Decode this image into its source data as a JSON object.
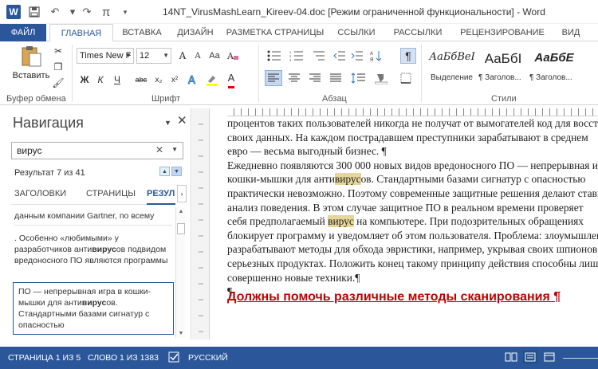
{
  "window": {
    "title": "14NT_VirusMashLearn_Kireev-04.doc [Режим ограниченной функциональности] - Word",
    "logo": "W",
    "qa_icons": [
      "save-icon",
      "undo-icon",
      "redo-icon",
      "pi-icon",
      "customize-icon"
    ],
    "qa_pi": "π"
  },
  "tabs": [
    "ФАЙЛ",
    "ГЛАВНАЯ",
    "ВСТАВКА",
    "ДИЗАЙН",
    "РАЗМЕТКА СТРАНИЦЫ",
    "ССЫЛКИ",
    "РАССЫЛКИ",
    "РЕЦЕНЗИРОВАНИЕ",
    "ВИД"
  ],
  "ribbon": {
    "clipboard": {
      "paste_label": "Вставить",
      "group_label": "Буфер обмена"
    },
    "font": {
      "font_name": "Times New F",
      "font_size": "12",
      "group_label": "Шрифт",
      "bold": "Ж",
      "italic": "К",
      "underline": "Ч",
      "strike": "abc",
      "sub": "x₂",
      "sup": "x²",
      "font_color_letter": "A",
      "grow": "A",
      "shrink": "A",
      "case": "Aa"
    },
    "paragraph": {
      "group_label": "Абзац"
    },
    "styles": {
      "group_label": "Стили",
      "items": [
        {
          "sample": "АаБбВеI",
          "name": "Выделение"
        },
        {
          "sample": "АаБбІ",
          "name": "¶ Заголов..."
        },
        {
          "sample": "АаБбЕ",
          "name": "¶ Заголов..."
        }
      ]
    }
  },
  "nav": {
    "title": "Навигация",
    "search_value": "вирус",
    "result_count": "Результат 7 из 41",
    "tabs": [
      "ЗАГОЛОВКИ",
      "СТРАНИЦЫ",
      "РЕЗУЛ"
    ],
    "results": [
      {
        "text": "данным компании Gartner, по всему"
      },
      {
        "text": ". Особенно «любимыми» у разработчиков анти",
        "bold": "вирус",
        "text2": "ов подвидом вредоносного ПО являются программы"
      },
      {
        "text": "ПО — непрерывная игра в кошки-мышки для анти",
        "bold": "вирус",
        "text2": "ов. Стандартными базами сигнатур с опасностью"
      }
    ]
  },
  "document": {
    "lines": [
      "процентов таких пользователей никогда не получат от вымогателей код для восстановления",
      "своих данных. На каждом пострадавшем преступники зарабатывают в среднем",
      "евро — весьма выгодный бизнес. ¶",
      "    Ежедневно появляются 300 000 новых видов вредоносного ПО — непрерывная игра в",
      "кошки-мышки для анти|вирус|ов. Стандартными базами сигнатур с опасностью",
      "практически невозможно. Поэтому современные защитные решения делают ставку на",
      "анализ поведения. В этом случае защитное ПО в реальном времени проверяет",
      "себя предполагаемый |вирус| на компьютере. При подозрительных обращениях",
      "блокирует программу и уведомляет об этом пользователя. Проблема: злоумышленники",
      "разрабатывают методы для обхода эвристики, например, укрывая своих шпионов в",
      "серьезных продуктах. Положить конец такому принципу действия способны лишь",
      "совершенно новые техники.¶",
      "¶"
    ],
    "heading": "Должны помочь различные методы сканирования ¶"
  },
  "status": {
    "page": "СТРАНИЦА 1 ИЗ 5",
    "words": "СЛОВО 1 ИЗ 1383",
    "language": "РУССКИЙ"
  }
}
